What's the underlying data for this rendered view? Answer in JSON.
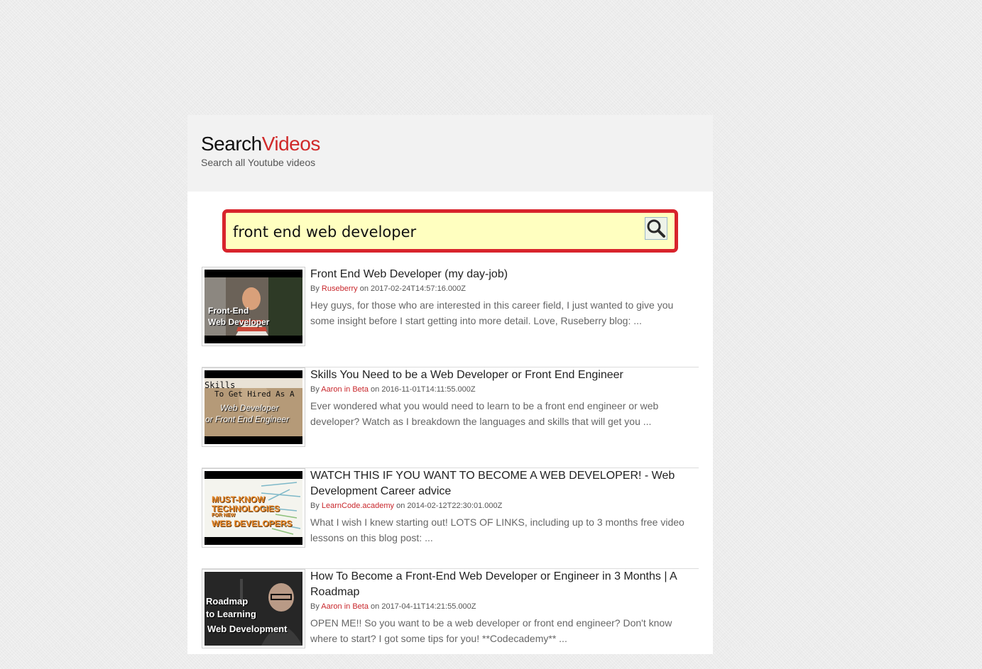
{
  "logo": {
    "part1": "Search",
    "part2": "Videos"
  },
  "tagline": "Search all Youtube videos",
  "search": {
    "value": "front end web developer"
  },
  "colors": {
    "accent": "#d02a2a",
    "search_bg": "#ffffc0",
    "search_border": "#d8242c"
  },
  "results": [
    {
      "title": "Front End Web Developer (my day-job)",
      "by": "By",
      "author": "Ruseberry",
      "on": "on",
      "date": "2017-02-24T14:57:16.000Z",
      "description": "Hey guys, for those who are interested in this career field, I just wanted to give you some insight before I start getting into more detail. Love, Ruseberry blog: ...",
      "thumb_caption": [
        "Front-End",
        "Web Developer"
      ]
    },
    {
      "title": "Skills You Need to be a Web Developer or Front End Engineer",
      "by": "By",
      "author": "Aaron in Beta",
      "on": "on",
      "date": "2016-11-01T14:11:55.000Z",
      "description": "Ever wondered what you would need to learn to be a front end engineer or web developer? Watch as I breakdown the languages and skills that will get you ...",
      "thumb_caption": [
        "Skills",
        "To Get Hired As A",
        "Web Developer",
        "or Front End Engineer"
      ]
    },
    {
      "title": "WATCH THIS IF YOU WANT TO BECOME A WEB DEVELOPER! - Web Development Career advice",
      "by": "By",
      "author": "LearnCode.academy",
      "on": "on",
      "date": "2014-02-12T22:30:01.000Z",
      "description": "What I wish I knew starting out! LOTS OF LINKS, including up to 3 months free video lessons on this blog post: ...",
      "thumb_caption": [
        "MUST-KNOW",
        "TECHNOLOGIES",
        "FOR NEW",
        "WEB DEVELOPERS"
      ]
    },
    {
      "title": "How To Become a Front-End Web Developer or Engineer in 3 Months | A Roadmap",
      "by": "By",
      "author": "Aaron in Beta",
      "on": "on",
      "date": "2017-04-11T14:21:55.000Z",
      "description": "OPEN ME!! So you want to be a web developer or front end engineer? Don't know where to start? I got some tips for you! **Codecademy** ...",
      "thumb_caption": [
        "Roadmap",
        "to Learning",
        "Web Development"
      ]
    }
  ]
}
